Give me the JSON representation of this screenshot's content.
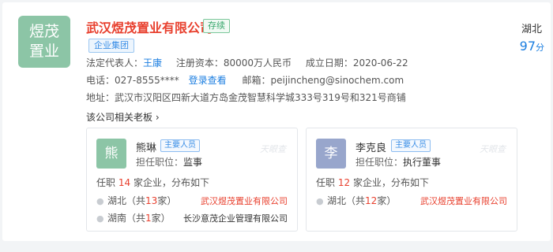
{
  "company": {
    "logo_text": "煜茂置业",
    "name": "武汉煜茂置业有限公司",
    "status": "存续",
    "group_tag": "企业集团",
    "region": "湖北",
    "score_value": "97",
    "score_unit": "分",
    "legal_rep_label": "法定代表人：",
    "legal_rep": "王康",
    "capital_label": "注册资本：",
    "capital": "80000万人民币",
    "date_label": "成立日期：",
    "date": "2020-06-22",
    "phone_label": "电话：",
    "phone": "027-8555****",
    "login_link": "登录查看",
    "email_label": "邮箱：",
    "email": "peijincheng@sinochem.com",
    "address_label": "地址：",
    "address": "武汉市汉阳区四新大道方岛金茂智慧科学城333号319号和321号商铺"
  },
  "section_title": "该公司相关老板",
  "section_chevron": "›",
  "people": [
    {
      "avatar": "熊",
      "avatar_color": "#8cc5a6",
      "name": "熊琳",
      "tag": "主要人员",
      "role_label": "担任职位：",
      "role": "监事",
      "watermark": "天眼查",
      "summary_prefix": "任职",
      "summary_count": "14",
      "summary_suffix": "家企业，分布如下",
      "regions": [
        {
          "region": "湖北",
          "open": "（共",
          "count": "13",
          "close": "家）",
          "company": "武汉煜茂置业有限公司",
          "company_color": "red"
        },
        {
          "region": "湖南",
          "open": "（共",
          "count": "1",
          "close": "家）",
          "company": "长沙意茂企业管理有限公司",
          "company_color": "dark"
        }
      ]
    },
    {
      "avatar": "李",
      "avatar_color": "#98a6cc",
      "name": "李克良",
      "tag": "主要人员",
      "role_label": "担任职位：",
      "role": "执行董事",
      "watermark": "天眼查",
      "summary_prefix": "任职",
      "summary_count": "12",
      "summary_suffix": "家企业，分布如下",
      "regions": [
        {
          "region": "湖北",
          "open": "（共",
          "count": "12",
          "close": "家）",
          "company": "武汉煜茂置业有限公司",
          "company_color": "red"
        }
      ]
    }
  ],
  "colors": {
    "accent_blue": "#1b7ee0",
    "accent_red": "#e8402e",
    "status_green": "#36a66b"
  }
}
